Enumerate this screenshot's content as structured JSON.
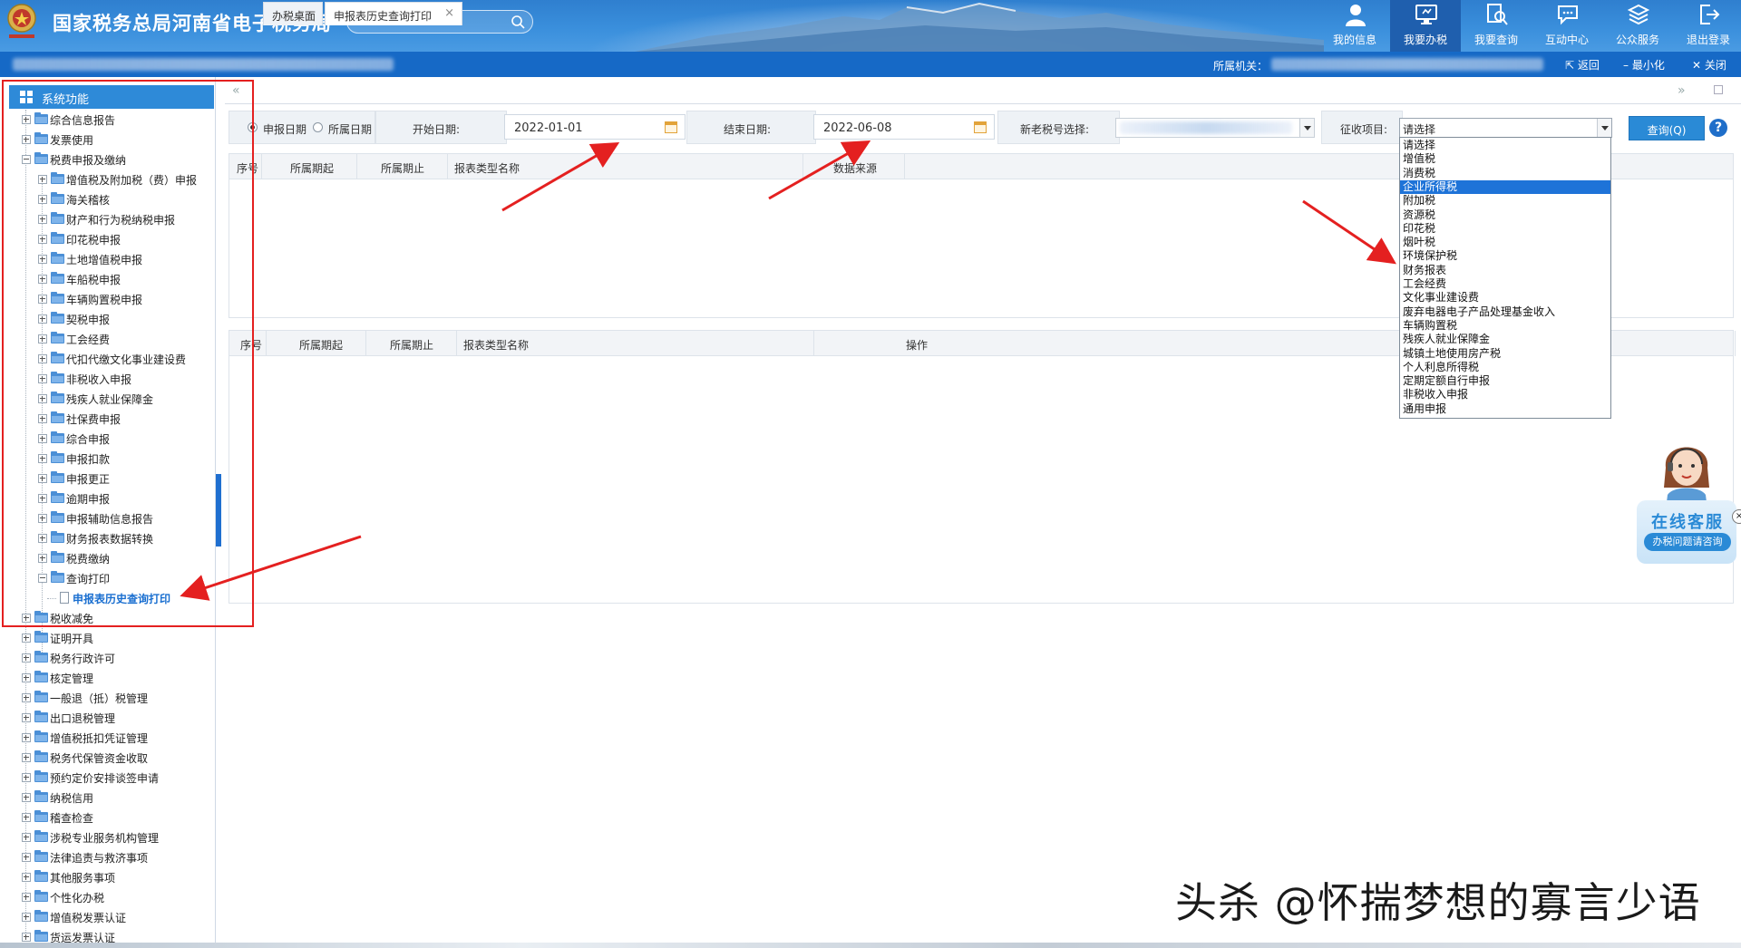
{
  "header": {
    "site_title": "国家税务总局河南省电子税务局",
    "nav": [
      {
        "label": "我的信息",
        "icon": "person-icon"
      },
      {
        "label": "我要办税",
        "icon": "monitor-icon"
      },
      {
        "label": "我要查询",
        "icon": "search-doc-icon"
      },
      {
        "label": "互动中心",
        "icon": "chat-icon"
      },
      {
        "label": "公众服务",
        "icon": "service-icon"
      },
      {
        "label": "退出登录",
        "icon": "logout-icon"
      }
    ],
    "active_nav": "我要办税"
  },
  "subbar": {
    "org_label": "所属机关：",
    "return_label": "返回",
    "minimize_label": "最小化",
    "close_label": "关闭"
  },
  "sidebar": {
    "title": "系统功能",
    "tree": [
      {
        "label": "综合信息报告",
        "level": 1,
        "state": "collapsed"
      },
      {
        "label": "发票使用",
        "level": 1,
        "state": "collapsed"
      },
      {
        "label": "税费申报及缴纳",
        "level": 1,
        "state": "expanded"
      },
      {
        "label": "增值税及附加税（费）申报",
        "level": 2,
        "state": "collapsed"
      },
      {
        "label": "海关稽核",
        "level": 2,
        "state": "collapsed"
      },
      {
        "label": "财产和行为税纳税申报",
        "level": 2,
        "state": "collapsed"
      },
      {
        "label": "印花税申报",
        "level": 2,
        "state": "collapsed"
      },
      {
        "label": "土地增值税申报",
        "level": 2,
        "state": "collapsed"
      },
      {
        "label": "车船税申报",
        "level": 2,
        "state": "collapsed"
      },
      {
        "label": "车辆购置税申报",
        "level": 2,
        "state": "collapsed"
      },
      {
        "label": "契税申报",
        "level": 2,
        "state": "collapsed"
      },
      {
        "label": "工会经费",
        "level": 2,
        "state": "collapsed"
      },
      {
        "label": "代扣代缴文化事业建设费",
        "level": 2,
        "state": "collapsed"
      },
      {
        "label": "非税收入申报",
        "level": 2,
        "state": "collapsed"
      },
      {
        "label": "残疾人就业保障金",
        "level": 2,
        "state": "collapsed"
      },
      {
        "label": "社保费申报",
        "level": 2,
        "state": "collapsed"
      },
      {
        "label": "综合申报",
        "level": 2,
        "state": "collapsed"
      },
      {
        "label": "申报扣款",
        "level": 2,
        "state": "collapsed"
      },
      {
        "label": "申报更正",
        "level": 2,
        "state": "collapsed"
      },
      {
        "label": "逾期申报",
        "level": 2,
        "state": "collapsed"
      },
      {
        "label": "申报辅助信息报告",
        "level": 2,
        "state": "collapsed"
      },
      {
        "label": "财务报表数据转换",
        "level": 2,
        "state": "collapsed"
      },
      {
        "label": "税费缴纳",
        "level": 2,
        "state": "collapsed"
      },
      {
        "label": "查询打印",
        "level": 2,
        "state": "expanded"
      },
      {
        "label": "申报表历史查询打印",
        "level": 3,
        "state": "leaf",
        "selected": true
      },
      {
        "label": "税收减免",
        "level": 1,
        "state": "collapsed"
      },
      {
        "label": "证明开具",
        "level": 1,
        "state": "collapsed"
      },
      {
        "label": "税务行政许可",
        "level": 1,
        "state": "collapsed"
      },
      {
        "label": "核定管理",
        "level": 1,
        "state": "collapsed"
      },
      {
        "label": "一般退（抵）税管理",
        "level": 1,
        "state": "collapsed"
      },
      {
        "label": "出口退税管理",
        "level": 1,
        "state": "collapsed"
      },
      {
        "label": "增值税抵扣凭证管理",
        "level": 1,
        "state": "collapsed"
      },
      {
        "label": "税务代保管资金收取",
        "level": 1,
        "state": "collapsed"
      },
      {
        "label": "预约定价安排谈签申请",
        "level": 1,
        "state": "collapsed"
      },
      {
        "label": "纳税信用",
        "level": 1,
        "state": "collapsed"
      },
      {
        "label": "稽查检查",
        "level": 1,
        "state": "collapsed"
      },
      {
        "label": "涉税专业服务机构管理",
        "level": 1,
        "state": "collapsed"
      },
      {
        "label": "法律追责与救济事项",
        "level": 1,
        "state": "collapsed"
      },
      {
        "label": "其他服务事项",
        "level": 1,
        "state": "collapsed"
      },
      {
        "label": "个性化办税",
        "level": 1,
        "state": "collapsed"
      },
      {
        "label": "增值税发票认证",
        "level": 1,
        "state": "collapsed"
      },
      {
        "label": "货运发票认证",
        "level": 1,
        "state": "collapsed"
      }
    ]
  },
  "tabs": [
    {
      "label": "办税桌面",
      "closable": false,
      "active": false
    },
    {
      "label": "申报表历史查询打印",
      "closable": true,
      "active": true
    }
  ],
  "filter": {
    "radio_declare": "申报日期",
    "radio_period": "所属日期",
    "start_label": "开始日期:",
    "start_value": "2022-01-01",
    "end_label": "结束日期:",
    "end_value": "2022-06-08",
    "taxno_label": "新老税号选择:",
    "item_label": "征收项目:",
    "item_value": "请选择",
    "query_button": "查询(Q)",
    "help": "?"
  },
  "dropdown": {
    "options": [
      "请选择",
      "增值税",
      "消费税",
      "企业所得税",
      "附加税",
      "资源税",
      "印花税",
      "烟叶税",
      "环境保护税",
      "财务报表",
      "工会经费",
      "文化事业建设费",
      "废弃电器电子产品处理基金收入",
      "车辆购置税",
      "残疾人就业保障金",
      "城镇土地使用房产税",
      "个人利息所得税",
      "定期定额自行申报",
      "非税收入申报",
      "通用申报"
    ],
    "highlighted": "企业所得税"
  },
  "grid1": {
    "columns": [
      "序号",
      "所属期起",
      "所属期止",
      "报表类型名称",
      "数据来源"
    ]
  },
  "grid2": {
    "columns": [
      "序号",
      "所属期起",
      "所属期止",
      "报表类型名称",
      "操作"
    ]
  },
  "customer_service": {
    "title": "在线客服",
    "subtitle": "办税问题请咨询",
    "close": "×"
  },
  "watermark": "头杀 @怀揣梦想的寡言少语",
  "colors": {
    "header_blue": "#3a8fdc",
    "subbar_blue": "#1669c6",
    "accent_blue": "#2a8ad6",
    "annotation_red": "#e42020",
    "highlight_blue": "#1e73d8"
  }
}
